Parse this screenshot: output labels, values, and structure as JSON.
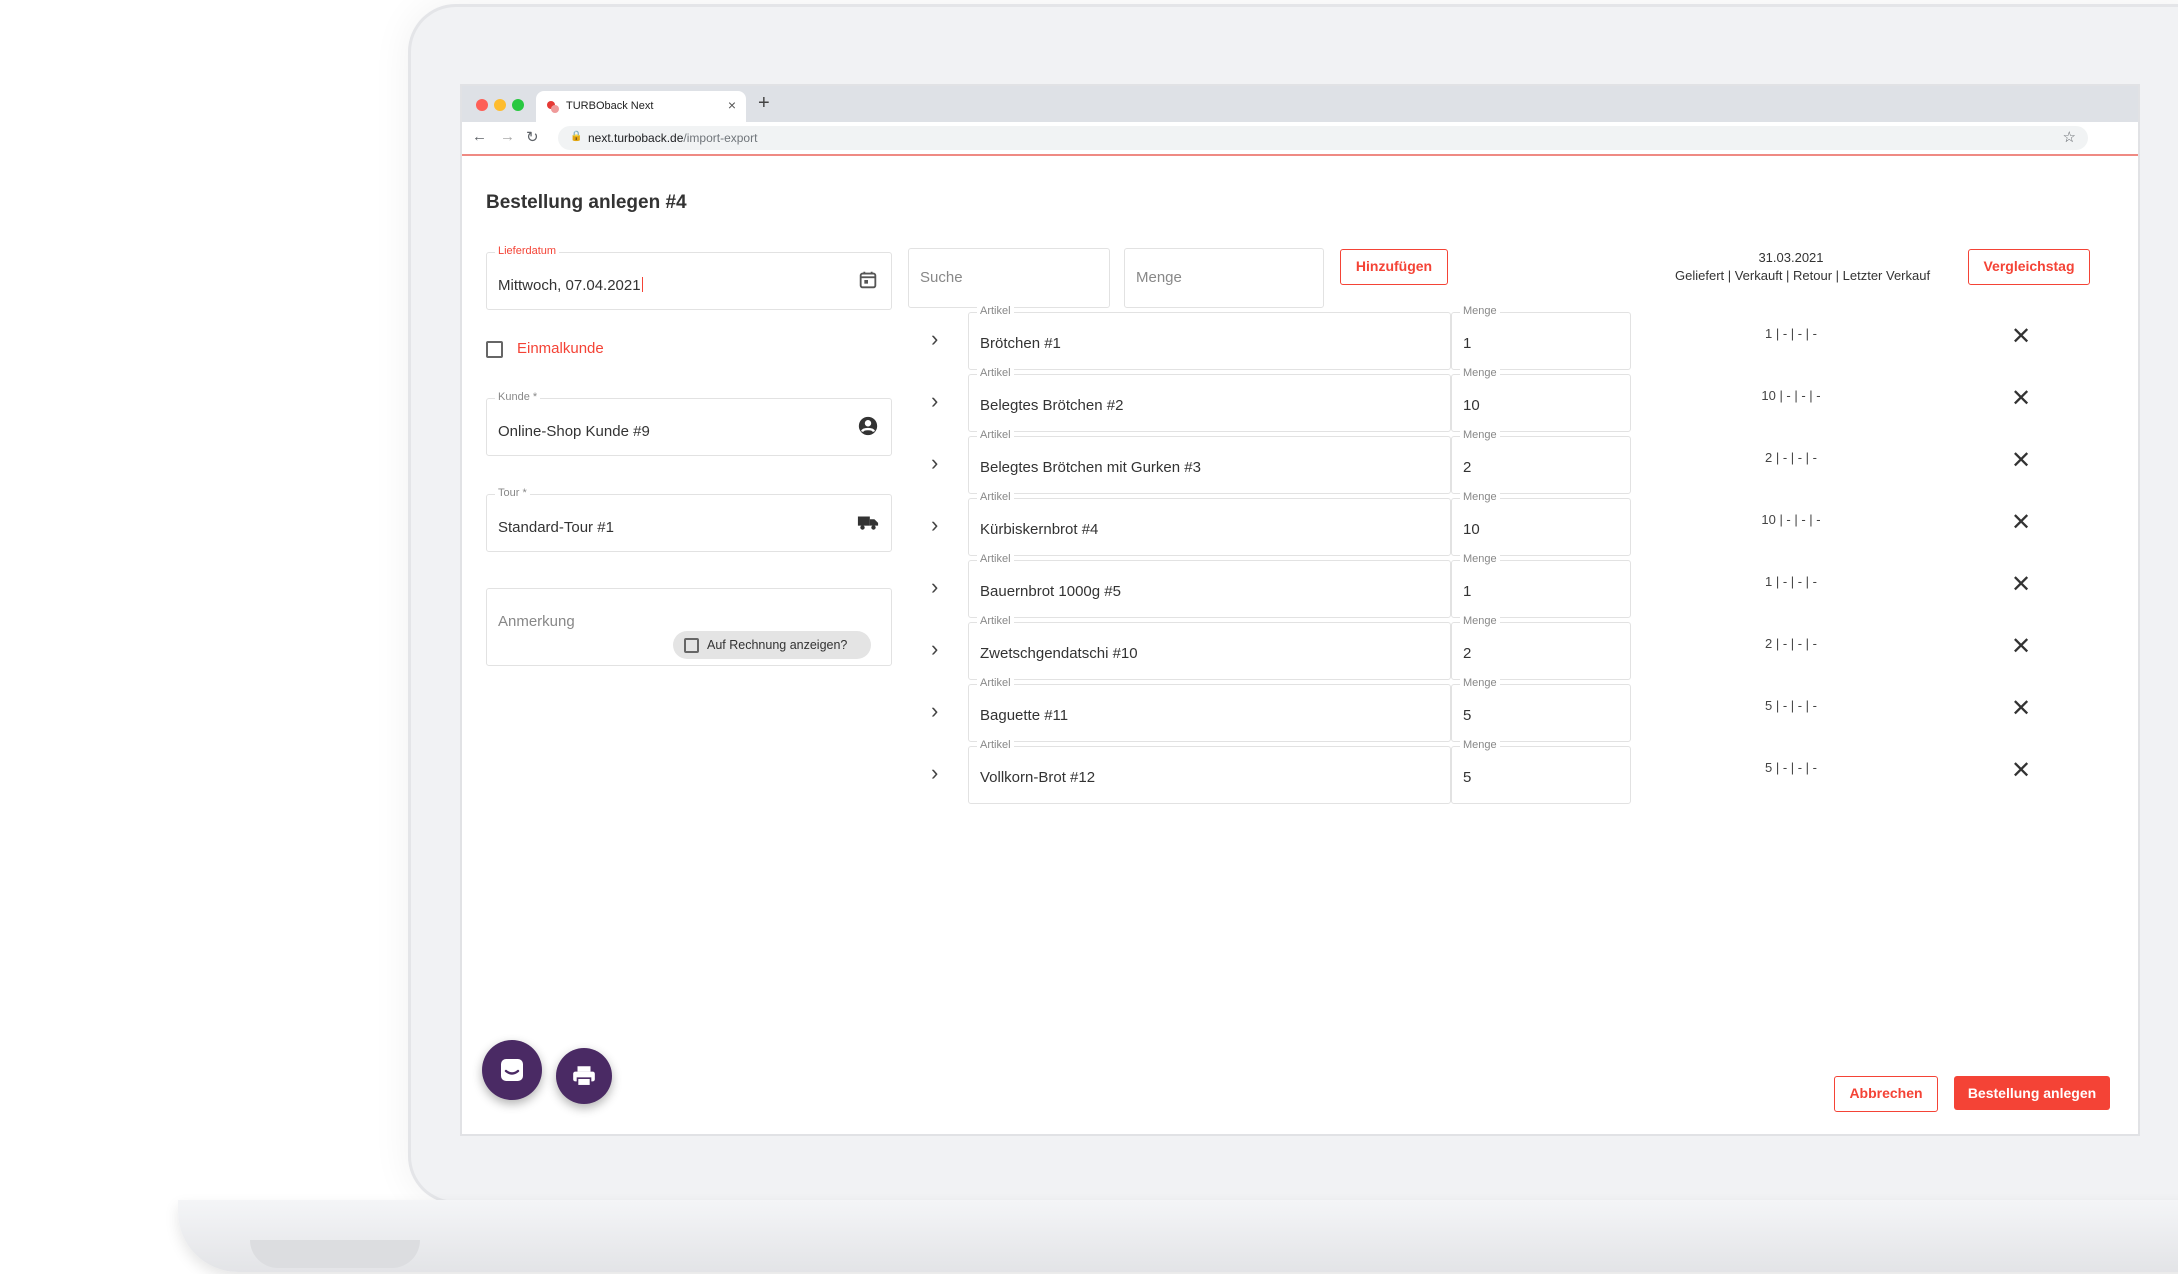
{
  "browser": {
    "tab_title": "TURBOback Next",
    "url_host": "next.turboback.de",
    "url_path": "/import-export"
  },
  "page": {
    "title": "Bestellung anlegen #4"
  },
  "form": {
    "lieferdatum": {
      "label": "Lieferdatum",
      "value": "Mittwoch, 07.04.2021"
    },
    "einmalkunde_label": "Einmalkunde",
    "kunde": {
      "label": "Kunde *",
      "value": "Online-Shop Kunde #9"
    },
    "tour": {
      "label": "Tour *",
      "value": "Standard-Tour #1"
    },
    "anmerkung_placeholder": "Anmerkung",
    "auf_rechnung_label": "Auf Rechnung anzeigen?"
  },
  "add_bar": {
    "search_placeholder": "Suche",
    "quantity_placeholder": "Menge",
    "add_button": "Hinzufügen"
  },
  "comparison": {
    "date": "31.03.2021",
    "header": "Geliefert | Verkauft | Retour | Letzter Verkauf",
    "button": "Vergleichstag"
  },
  "items_labels": {
    "article": "Artikel",
    "quantity": "Menge"
  },
  "items": [
    {
      "article": "Brötchen #1",
      "quantity": "1",
      "stats": "1 | - | - | -"
    },
    {
      "article": "Belegtes Brötchen #2",
      "quantity": "10",
      "stats": "10 | - | - | -"
    },
    {
      "article": "Belegtes Brötchen mit Gurken #3",
      "quantity": "2",
      "stats": "2 | - | - | -"
    },
    {
      "article": "Kürbiskernbrot #4",
      "quantity": "10",
      "stats": "10 | - | - | -"
    },
    {
      "article": "Bauernbrot 1000g #5",
      "quantity": "1",
      "stats": "1 | - | - | -"
    },
    {
      "article": "Zwetschgendatschi #10",
      "quantity": "2",
      "stats": "2 | - | - | -"
    },
    {
      "article": "Baguette #11",
      "quantity": "5",
      "stats": "5 | - | - | -"
    },
    {
      "article": "Vollkorn-Brot #12",
      "quantity": "5",
      "stats": "5 | - | - | -"
    }
  ],
  "footer": {
    "cancel_button": "Abbrechen",
    "submit_button": "Bestellung anlegen"
  },
  "colors": {
    "accent": "#f44336",
    "fab": "#4a2a64"
  }
}
